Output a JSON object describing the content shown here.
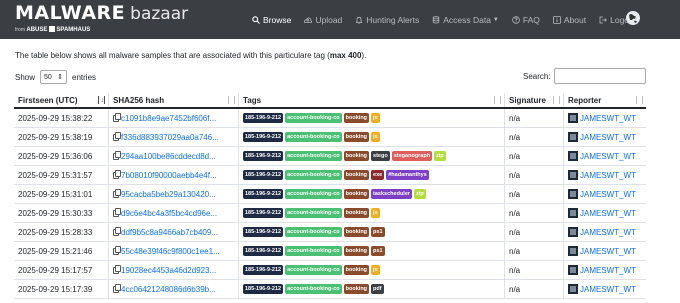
{
  "brand": {
    "name": "MALWARE",
    "sub": "bazaar",
    "from_text": "from",
    "abuse": "ABUSE",
    "spamhaus": "SPAMHAUS"
  },
  "nav": [
    {
      "label": "Browse",
      "icon": "search-icon",
      "active": true
    },
    {
      "label": "Upload",
      "icon": "upload-icon",
      "active": false
    },
    {
      "label": "Hunting Alerts",
      "icon": "bell-icon",
      "active": false
    },
    {
      "label": "Access Data",
      "icon": "database-icon",
      "active": false,
      "dropdown": true
    },
    {
      "label": "FAQ",
      "icon": "question-icon",
      "active": false
    },
    {
      "label": "About",
      "icon": "info-icon",
      "active": false
    },
    {
      "label": "Logout",
      "icon": "logout-icon",
      "active": false
    }
  ],
  "intro": {
    "text": "The table below shows all malware samples that are associated with this particulare tag (",
    "bold": "max 400",
    "end": ")."
  },
  "length": {
    "show": "Show",
    "value": "50",
    "entries": "entries"
  },
  "search": {
    "label": "Search:",
    "placeholder": ""
  },
  "columns": [
    "Firstseen (UTC)",
    "SHA256 hash",
    "Tags",
    "Signature",
    "Reporter"
  ],
  "tag_colors": {
    "185-196-9-212": "#1f2a44",
    "account-booking-co": "#4bbf73",
    "booking": "#8a4b2c",
    "js": "#f0ad20",
    "ps1": "#8a4b2c",
    "stego": "#3b3f44",
    "steganograph": "#e05d5d",
    "zip": "#b6dd3f",
    "exe": "#8a2b2b",
    "#hadamanthys": "#7d3fc7",
    "taskscheduler": "#7d3fc7",
    "pdf": "#3b3f44"
  },
  "rows": [
    {
      "date": "2025-09-29 15:38:22",
      "hash": "c1091b8e9ae7452bf606f...",
      "tags": [
        "185-196-9-212",
        "account-booking-co",
        "booking",
        "js"
      ],
      "signature": "n/a",
      "reporter": "JAMESWT_WT"
    },
    {
      "date": "2025-09-29 15:38:19",
      "hash": "f336d883937029aa0a746...",
      "tags": [
        "185-196-9-212",
        "account-booking-co",
        "booking",
        "js"
      ],
      "signature": "n/a",
      "reporter": "JAMESWT_WT"
    },
    {
      "date": "2025-09-29 15:36:06",
      "hash": "294aa100be86cddecd8d...",
      "tags": [
        "185-196-9-212",
        "account-booking-co",
        "booking",
        "stego",
        "steganograph",
        "zip"
      ],
      "signature": "n/a",
      "reporter": "JAMESWT_WT"
    },
    {
      "date": "2025-09-29 15:31:57",
      "hash": "7b08010f90000aebb4e4f...",
      "tags": [
        "185-196-9-212",
        "account-booking-co",
        "booking",
        "exe",
        "#hadamanthys"
      ],
      "signature": "n/a",
      "reporter": "JAMESWT_WT"
    },
    {
      "date": "2025-09-29 15:31:01",
      "hash": "95cacba5beb29a130420...",
      "tags": [
        "185-196-9-212",
        "account-booking-co",
        "booking",
        "taskscheduler",
        "zip"
      ],
      "signature": "n/a",
      "reporter": "JAMESWT_WT"
    },
    {
      "date": "2025-09-29 15:30:33",
      "hash": "d9c6e4bc4a3f5bc4cd96e...",
      "tags": [
        "185-196-9-212",
        "account-booking-co",
        "booking",
        "js"
      ],
      "signature": "n/a",
      "reporter": "JAMESWT_WT"
    },
    {
      "date": "2025-09-29 15:28:33",
      "hash": "ddf9b5c8a9466ab7cb409...",
      "tags": [
        "185-196-9-212",
        "account-booking-co",
        "booking",
        "ps1"
      ],
      "signature": "n/a",
      "reporter": "JAMESWT_WT"
    },
    {
      "date": "2025-09-29 15:21:46",
      "hash": "55c48e39f46c9f800c1ee1...",
      "tags": [
        "185-196-9-212",
        "account-booking-co",
        "booking",
        "ps1"
      ],
      "signature": "n/a",
      "reporter": "JAMESWT_WT"
    },
    {
      "date": "2025-09-29 15:17:57",
      "hash": "19028ec4453a46d2d923...",
      "tags": [
        "185-196-9-212",
        "account-booking-co",
        "booking",
        "js"
      ],
      "signature": "n/a",
      "reporter": "JAMESWT_WT"
    },
    {
      "date": "2025-09-29 15:17:39",
      "hash": "4cc06421248086d6b39b...",
      "tags": [
        "185-196-9-212",
        "account-booking-co",
        "booking",
        "pdf"
      ],
      "signature": "n/a",
      "reporter": "JAMESWT_WT"
    }
  ]
}
